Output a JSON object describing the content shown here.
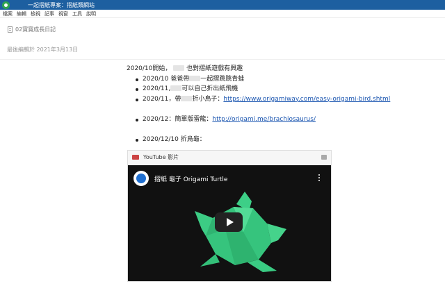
{
  "window": {
    "title": "一起摺紙專案：摺紙類網站"
  },
  "menu": [
    "檔案",
    "編輯",
    "檢視",
    "記事",
    "視窗",
    "工具",
    "說明"
  ],
  "note": {
    "notebook": "02寶寶成長日記",
    "last_edited": "最後編輯於 2021年3月13日"
  },
  "content": {
    "intro_a": "2020/10開始，",
    "intro_b": "也對摺紙遊戲有興趣",
    "items": [
      {
        "a": "2020/10 爸爸帶",
        "b": "一起摺跳跳青蛙"
      },
      {
        "a": "2020/11,",
        "b": "可以自己折出紙飛機"
      },
      {
        "a": "2020/11，帶",
        "b": "折小鳥子：",
        "link": "https://www.origamiway.com/easy-origami-bird.shtml"
      },
      {
        "a": "2020/12：簡單版雷龍：",
        "link": "http://origami.me/brachiosaurus/"
      },
      {
        "a": "2020/12/10 折烏龜："
      }
    ]
  },
  "youtube": {
    "header_label": "YouTube 影片",
    "video_title": "摺紙 龜子 Origami Turtle"
  },
  "colors": {
    "titlebar": "#1d5fa0",
    "link": "#1a55b0",
    "turtle": "#3dcf87"
  },
  "icons": {
    "app": "evernote-logo-icon",
    "notebook": "notebook-icon",
    "play": "play-icon",
    "more": "more-vert-icon"
  }
}
